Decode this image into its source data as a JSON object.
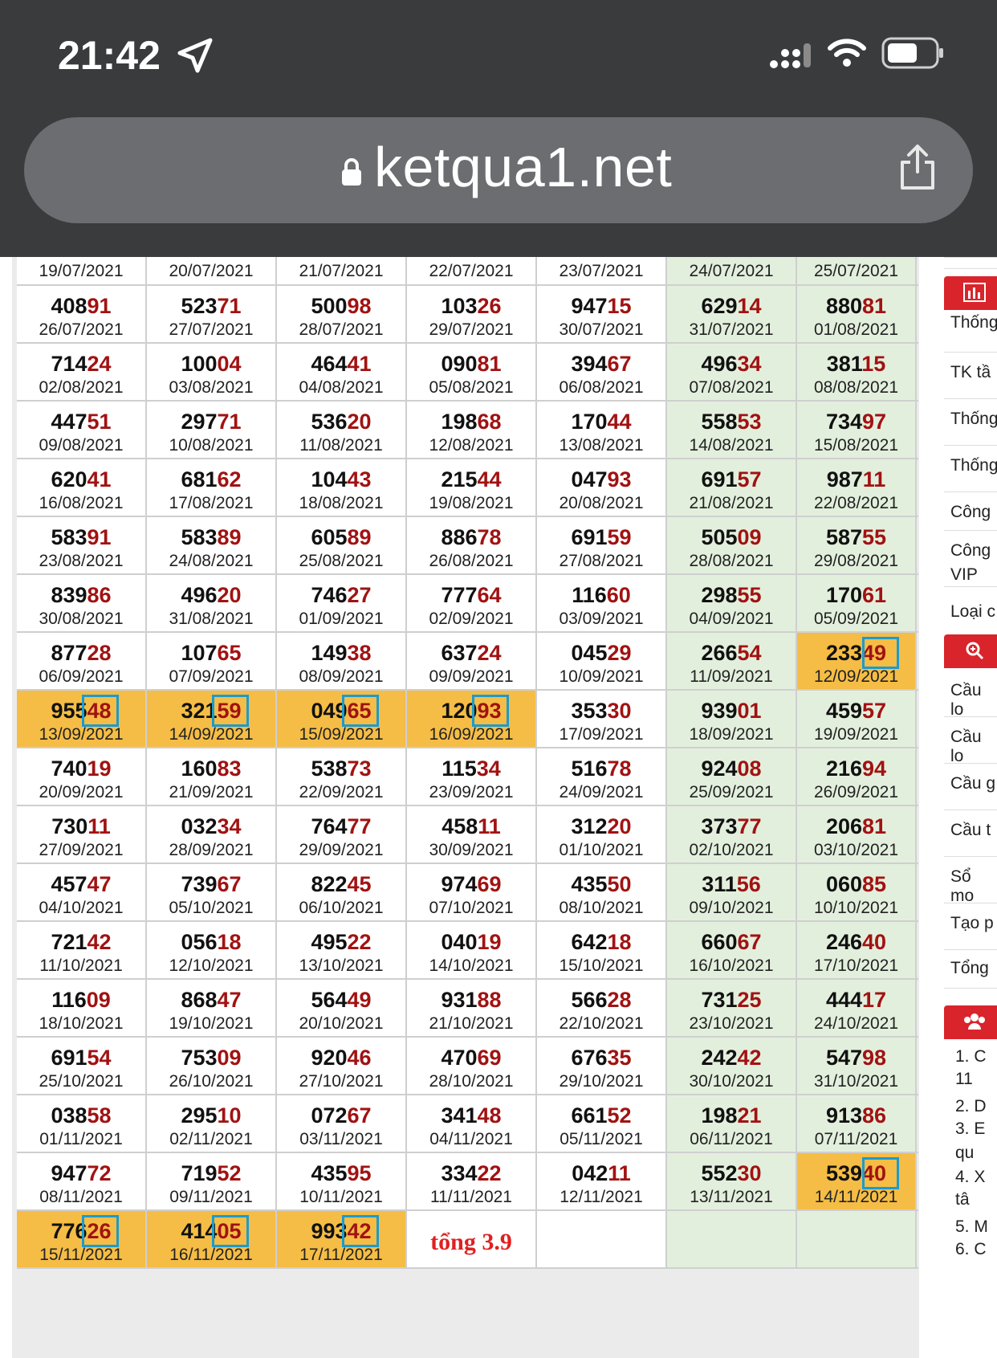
{
  "status": {
    "time": "21:42"
  },
  "browser": {
    "url": "ketqua1.net"
  },
  "sidebar": {
    "items1": [
      "Thống",
      "TK tầ",
      "Thống",
      "Thống",
      "Công",
      "Công",
      "VIP",
      "Loại c"
    ],
    "items2": [
      "Cầu lo",
      "Cầu lo",
      "Cầu g",
      "Cầu t",
      "Sổ mo",
      "Tạo p",
      "Tổng"
    ],
    "list": [
      "1.  C",
      "11",
      "2.  D",
      "3.  E",
      "qu",
      "4.  X",
      "tâ",
      "5.  M",
      "6.  C"
    ]
  },
  "table": {
    "rows": [
      [
        [
          "",
          "19/07/2021"
        ],
        [
          "",
          "20/07/2021"
        ],
        [
          "",
          "21/07/2021"
        ],
        [
          "",
          "22/07/2021"
        ],
        [
          "",
          "23/07/2021"
        ],
        [
          "",
          "24/07/2021"
        ],
        [
          "",
          "25/07/2021"
        ]
      ],
      [
        [
          "40891",
          "26/07/2021"
        ],
        [
          "52371",
          "27/07/2021"
        ],
        [
          "50098",
          "28/07/2021"
        ],
        [
          "10326",
          "29/07/2021"
        ],
        [
          "94715",
          "30/07/2021"
        ],
        [
          "62914",
          "31/07/2021"
        ],
        [
          "88081",
          "01/08/2021"
        ]
      ],
      [
        [
          "71424",
          "02/08/2021"
        ],
        [
          "10004",
          "03/08/2021"
        ],
        [
          "46441",
          "04/08/2021"
        ],
        [
          "09081",
          "05/08/2021"
        ],
        [
          "39467",
          "06/08/2021"
        ],
        [
          "49634",
          "07/08/2021"
        ],
        [
          "38115",
          "08/08/2021"
        ]
      ],
      [
        [
          "44751",
          "09/08/2021"
        ],
        [
          "29771",
          "10/08/2021"
        ],
        [
          "53620",
          "11/08/2021"
        ],
        [
          "19868",
          "12/08/2021"
        ],
        [
          "17044",
          "13/08/2021"
        ],
        [
          "55853",
          "14/08/2021"
        ],
        [
          "73497",
          "15/08/2021"
        ]
      ],
      [
        [
          "62041",
          "16/08/2021"
        ],
        [
          "68162",
          "17/08/2021"
        ],
        [
          "10443",
          "18/08/2021"
        ],
        [
          "21544",
          "19/08/2021"
        ],
        [
          "04793",
          "20/08/2021"
        ],
        [
          "69157",
          "21/08/2021"
        ],
        [
          "98711",
          "22/08/2021"
        ]
      ],
      [
        [
          "58391",
          "23/08/2021"
        ],
        [
          "58389",
          "24/08/2021"
        ],
        [
          "60589",
          "25/08/2021"
        ],
        [
          "88678",
          "26/08/2021"
        ],
        [
          "69159",
          "27/08/2021"
        ],
        [
          "50509",
          "28/08/2021"
        ],
        [
          "58755",
          "29/08/2021"
        ]
      ],
      [
        [
          "83986",
          "30/08/2021"
        ],
        [
          "49620",
          "31/08/2021"
        ],
        [
          "74627",
          "01/09/2021"
        ],
        [
          "77764",
          "02/09/2021"
        ],
        [
          "11660",
          "03/09/2021"
        ],
        [
          "29855",
          "04/09/2021"
        ],
        [
          "17061",
          "05/09/2021"
        ]
      ],
      [
        [
          "87728",
          "06/09/2021"
        ],
        [
          "10765",
          "07/09/2021"
        ],
        [
          "14938",
          "08/09/2021"
        ],
        [
          "63724",
          "09/09/2021"
        ],
        [
          "04529",
          "10/09/2021"
        ],
        [
          "26654",
          "11/09/2021"
        ],
        [
          "23349",
          "12/09/2021"
        ]
      ],
      [
        [
          "95548",
          "13/09/2021"
        ],
        [
          "32159",
          "14/09/2021"
        ],
        [
          "04965",
          "15/09/2021"
        ],
        [
          "12093",
          "16/09/2021"
        ],
        [
          "35330",
          "17/09/2021"
        ],
        [
          "93901",
          "18/09/2021"
        ],
        [
          "45957",
          "19/09/2021"
        ]
      ],
      [
        [
          "74019",
          "20/09/2021"
        ],
        [
          "16083",
          "21/09/2021"
        ],
        [
          "53873",
          "22/09/2021"
        ],
        [
          "11534",
          "23/09/2021"
        ],
        [
          "51678",
          "24/09/2021"
        ],
        [
          "92408",
          "25/09/2021"
        ],
        [
          "21694",
          "26/09/2021"
        ]
      ],
      [
        [
          "73011",
          "27/09/2021"
        ],
        [
          "03234",
          "28/09/2021"
        ],
        [
          "76477",
          "29/09/2021"
        ],
        [
          "45811",
          "30/09/2021"
        ],
        [
          "31220",
          "01/10/2021"
        ],
        [
          "37377",
          "02/10/2021"
        ],
        [
          "20681",
          "03/10/2021"
        ]
      ],
      [
        [
          "45747",
          "04/10/2021"
        ],
        [
          "73967",
          "05/10/2021"
        ],
        [
          "82245",
          "06/10/2021"
        ],
        [
          "97469",
          "07/10/2021"
        ],
        [
          "43550",
          "08/10/2021"
        ],
        [
          "31156",
          "09/10/2021"
        ],
        [
          "06085",
          "10/10/2021"
        ]
      ],
      [
        [
          "72142",
          "11/10/2021"
        ],
        [
          "05618",
          "12/10/2021"
        ],
        [
          "49522",
          "13/10/2021"
        ],
        [
          "04019",
          "14/10/2021"
        ],
        [
          "64218",
          "15/10/2021"
        ],
        [
          "66067",
          "16/10/2021"
        ],
        [
          "24640",
          "17/10/2021"
        ]
      ],
      [
        [
          "11609",
          "18/10/2021"
        ],
        [
          "86847",
          "19/10/2021"
        ],
        [
          "56449",
          "20/10/2021"
        ],
        [
          "93188",
          "21/10/2021"
        ],
        [
          "56628",
          "22/10/2021"
        ],
        [
          "73125",
          "23/10/2021"
        ],
        [
          "44417",
          "24/10/2021"
        ]
      ],
      [
        [
          "69154",
          "25/10/2021"
        ],
        [
          "75309",
          "26/10/2021"
        ],
        [
          "92046",
          "27/10/2021"
        ],
        [
          "47069",
          "28/10/2021"
        ],
        [
          "67635",
          "29/10/2021"
        ],
        [
          "24242",
          "30/10/2021"
        ],
        [
          "54798",
          "31/10/2021"
        ]
      ],
      [
        [
          "03858",
          "01/11/2021"
        ],
        [
          "29510",
          "02/11/2021"
        ],
        [
          "07267",
          "03/11/2021"
        ],
        [
          "34148",
          "04/11/2021"
        ],
        [
          "66152",
          "05/11/2021"
        ],
        [
          "19821",
          "06/11/2021"
        ],
        [
          "91386",
          "07/11/2021"
        ]
      ],
      [
        [
          "94772",
          "08/11/2021"
        ],
        [
          "71952",
          "09/11/2021"
        ],
        [
          "43595",
          "10/11/2021"
        ],
        [
          "33422",
          "11/11/2021"
        ],
        [
          "04211",
          "12/11/2021"
        ],
        [
          "55230",
          "13/11/2021"
        ],
        [
          "53940",
          "14/11/2021"
        ]
      ],
      [
        [
          "77626",
          "15/11/2021"
        ],
        [
          "41405",
          "16/11/2021"
        ],
        [
          "99342",
          "17/11/2021"
        ],
        [
          "tổng 3.9",
          ""
        ],
        [
          "",
          ""
        ],
        [
          "",
          ""
        ],
        [
          "",
          ""
        ]
      ]
    ],
    "highlighted": [
      "7-6",
      "8-0",
      "8-1",
      "8-2",
      "8-3",
      "16-6",
      "17-0",
      "17-1",
      "17-2"
    ],
    "colors": {
      "highlight": "#f5bd45",
      "weekend": "#e3efdd",
      "box": "#1a9bd0",
      "tail": "#a11212"
    }
  }
}
